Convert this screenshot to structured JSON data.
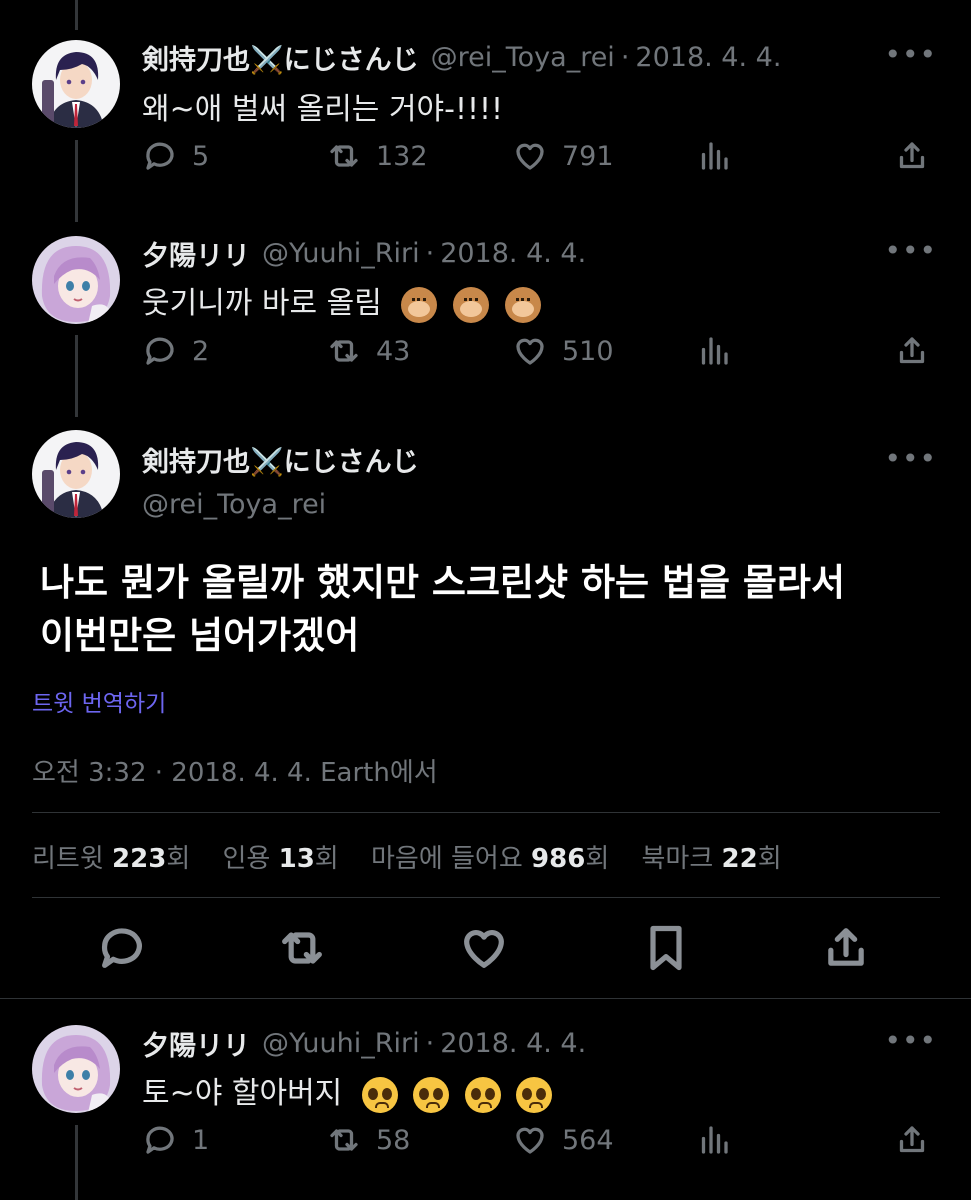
{
  "tweets": [
    {
      "name": "剣持刀也⚔️にじさんじ",
      "handle": "@rei_Toya_rei",
      "date": "2018. 4. 4.",
      "text": "왜~애 벌써 올리는 거야-!!!!",
      "replies": "5",
      "retweets": "132",
      "likes": "791"
    },
    {
      "name": "夕陽リリ",
      "handle": "@Yuuhi_Riri",
      "date": "2018. 4. 4.",
      "text": "웃기니까 바로 올림",
      "emoji": "🐵🐵🐵",
      "replies": "2",
      "retweets": "43",
      "likes": "510"
    },
    {
      "name": "夕陽リリ",
      "handle": "@Yuuhi_Riri",
      "date": "2018. 4. 4.",
      "text": "토~야 할아버지",
      "emoji": "🥹🥹🥹🥹",
      "replies": "1",
      "retweets": "58",
      "likes": "564"
    }
  ],
  "main_tweet": {
    "name": "剣持刀也⚔️にじさんじ",
    "handle": "@rei_Toya_rei",
    "text_line1": "나도 뭔가 올릴까 했지만 스크린샷 하는 법을 몰라서",
    "text_line2": "이번만은 넘어가겠어",
    "translate": "트윗 번역하기",
    "timestamp": "오전 3:32 · 2018. 4. 4. Earth에서",
    "stats": {
      "retweets_label": "리트윗",
      "retweets": "223",
      "retweets_unit": "회",
      "quotes_label": "인용",
      "quotes": "13",
      "quotes_unit": "회",
      "likes_label": "마음에 들어요",
      "likes": "986",
      "likes_unit": "회",
      "bookmarks_label": "북마크",
      "bookmarks": "22",
      "bookmarks_unit": "회"
    }
  },
  "ui": {
    "more": "•••",
    "dot_sep": "·"
  },
  "colors": {
    "background": "#000000",
    "text": "#e7e9ea",
    "muted": "#71767b",
    "link": "#6d66f0"
  }
}
